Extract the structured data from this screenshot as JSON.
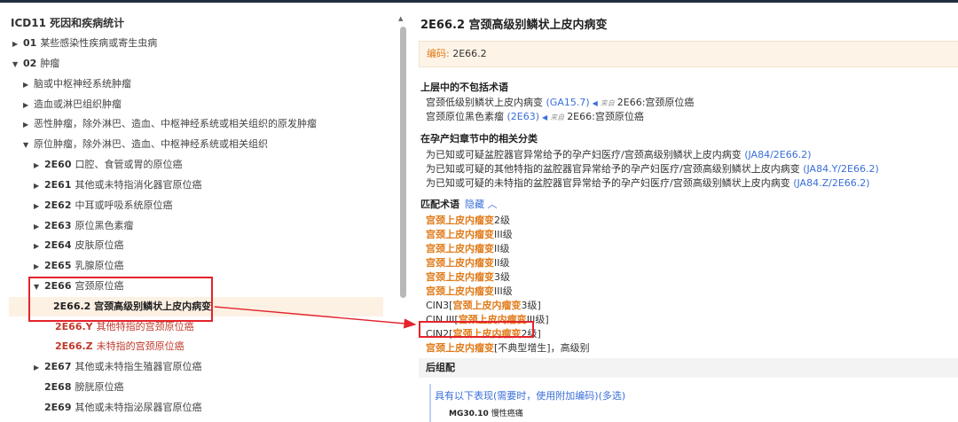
{
  "tree": {
    "title": "ICD11 死因和疾病统计",
    "nodes": [
      {
        "arrow": "▶",
        "code": "01",
        "label": "某些感染性疾病或寄生虫病"
      },
      {
        "arrow": "▼",
        "code": "02",
        "label": "肿瘤"
      },
      {
        "arrow": "▶",
        "code": "",
        "label": "脑或中枢神经系统肿瘤"
      },
      {
        "arrow": "▶",
        "code": "",
        "label": "造血或淋巴组织肿瘤"
      },
      {
        "arrow": "▶",
        "code": "",
        "label": "恶性肿瘤，除外淋巴、造血、中枢神经系统或相关组织的原发肿瘤"
      },
      {
        "arrow": "▼",
        "code": "",
        "label": "原位肿瘤，除外淋巴、造血、中枢神经系统或相关组织"
      },
      {
        "arrow": "▶",
        "code": "2E60",
        "label": "口腔、食管或胃的原位癌"
      },
      {
        "arrow": "▶",
        "code": "2E61",
        "label": "其他或未特指消化器官原位癌"
      },
      {
        "arrow": "▶",
        "code": "2E62",
        "label": "中耳或呼吸系统原位癌"
      },
      {
        "arrow": "▶",
        "code": "2E63",
        "label": "原位黑色素瘤"
      },
      {
        "arrow": "▶",
        "code": "2E64",
        "label": "皮肤原位癌"
      },
      {
        "arrow": "▶",
        "code": "2E65",
        "label": "乳腺原位癌"
      },
      {
        "arrow": "▼",
        "code": "2E66",
        "label": "宫颈原位癌"
      },
      {
        "arrow": "",
        "code": "",
        "label": "2E66.2 宫颈高级别鳞状上皮内病变"
      },
      {
        "arrow": "",
        "code": "2E66.Y",
        "label": "其他特指的宫颈原位癌"
      },
      {
        "arrow": "",
        "code": "2E66.Z",
        "label": "未特指的宫颈原位癌"
      },
      {
        "arrow": "▶",
        "code": "2E67",
        "label": "其他或未特指生殖器官原位癌"
      },
      {
        "arrow": "",
        "code": "2E68",
        "label": "膀胱原位癌"
      },
      {
        "arrow": "",
        "code": "2E69",
        "label": "其他或未特指泌尿器官原位癌"
      }
    ]
  },
  "detail": {
    "title": "2E66.2 宫颈高级别鳞状上皮内病变",
    "code_key": "编码:",
    "code_value": "2E66.2",
    "sec_exclusion": "上层中的不包括术语",
    "exclusions": [
      {
        "text": "宫颈低级别鳞状上皮内病变",
        "link": "(GA15.7)",
        "from": "来自",
        "parent": "2E66:宫颈原位癌"
      },
      {
        "text": "宫颈原位黑色素瘤",
        "link": "(2E63)",
        "from": "来自",
        "parent": "2E66:宫颈原位癌"
      }
    ],
    "sec_perinatal": "在孕产妇章节中的相关分类",
    "perinatal": [
      {
        "text": "为已知或可疑盆腔器官异常给予的孕产妇医疗/宫颈高级别鳞状上皮内病变",
        "link": "(JA84/2E66.2)"
      },
      {
        "text": "为已知或可疑的其他特指的盆腔器官异常给予的孕产妇医疗/宫颈高级别鳞状上皮内病变",
        "link": "(JA84.Y/2E66.2)"
      },
      {
        "text": "为已知或可疑的未特指的盆腔器官异常给予的孕产妇医疗/宫颈高级别鳞状上皮内病变",
        "link": "(JA84.Z/2E66.2)"
      }
    ],
    "sec_index": "匹配术语",
    "hide_label": "隐藏 ︿",
    "index_terms": [
      {
        "pre": "",
        "hl": "宫颈上皮内瘤变",
        "post": "2级"
      },
      {
        "pre": "",
        "hl": "宫颈上皮内瘤变",
        "post": "III级"
      },
      {
        "pre": "",
        "hl": "宫颈上皮内瘤变",
        "post": "II级"
      },
      {
        "pre": "",
        "hl": "宫颈上皮内瘤变",
        "post": "II级"
      },
      {
        "pre": "",
        "hl": "宫颈上皮内瘤变",
        "post": "3级"
      },
      {
        "pre": "",
        "hl": "宫颈上皮内瘤变",
        "post": "III级"
      },
      {
        "pre": "CIN3[",
        "hl": "宫颈上皮内瘤变",
        "post": "3级]"
      },
      {
        "pre": "CIN III[",
        "hl": "宫颈上皮内瘤变",
        "post": "III级]"
      },
      {
        "pre": "CIN2[",
        "hl": "宫颈上皮内瘤变",
        "post": "2级]"
      },
      {
        "pre": "",
        "hl": "宫颈上皮内瘤变",
        "post": "[不典型增生]，高级别"
      }
    ],
    "sec_post": "后组配",
    "post_text": "具有以下表现(需要时，使用附加编码)(多选)",
    "post_item_code": "MG30.10",
    "post_item_label": "慢性癌痛"
  },
  "colors": {
    "highlight": "#e07b1a",
    "link": "#3a6fd8",
    "annotation": "#e3242b"
  }
}
